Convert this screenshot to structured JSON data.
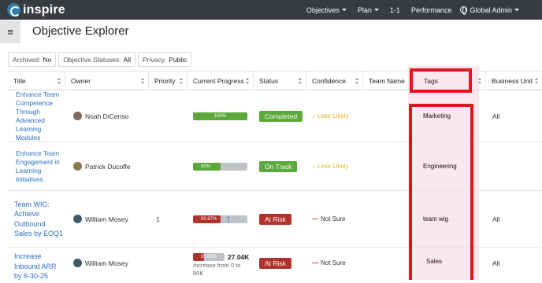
{
  "nav": {
    "logo": "inspire",
    "items": [
      {
        "label": "Objectives",
        "dropdown": true
      },
      {
        "label": "Plan",
        "dropdown": true
      },
      {
        "label": "1-1",
        "dropdown": false
      },
      {
        "label": "Performance",
        "dropdown": false
      },
      {
        "label": "Global Admin",
        "dropdown": true
      }
    ]
  },
  "header": {
    "title": "Objective Explorer",
    "menu_icon": "≡"
  },
  "filters": [
    {
      "label": "Archived:",
      "value": "No"
    },
    {
      "label": "Objective Statuses:",
      "value": "All"
    },
    {
      "label": "Privacy:",
      "value": "Public"
    }
  ],
  "columns": [
    "Title",
    "Owner",
    "Priority",
    "Current Progress",
    "Status",
    "Confidence",
    "Team Name",
    "Tags",
    "Business Unit"
  ],
  "rows": [
    {
      "title": "Enhance Team Competence Through Advanced Learning Modules",
      "owner": "Noah DiCenso",
      "priority": "",
      "progress_label": "100%",
      "progress_value": 100,
      "progress_color": "#5aa93a",
      "status": "Completed",
      "status_color": "#5aa93a",
      "confidence": "Less Likely",
      "confidence_icon": "↓",
      "confidence_color": "#e6b422",
      "team": "",
      "tag": "Marketing",
      "business_unit": "All"
    },
    {
      "title": "Enhance Team Engagement in Learning Initiatives",
      "owner": "Patrick Ducoffe",
      "priority": "",
      "progress_label": "50%",
      "progress_value": 50,
      "progress_color": "#5aa93a",
      "status": "On Track",
      "status_color": "#5aa93a",
      "confidence": "Less Likely",
      "confidence_icon": "↓",
      "confidence_color": "#e6b422",
      "team": "",
      "tag": "Engineering",
      "business_unit": ""
    },
    {
      "title": "Team WIG: Achieve Outbound Sales by EOQ1",
      "owner": "William Mosey",
      "priority": "1",
      "progress_label": "50.67%",
      "progress_value": 50.67,
      "progress_color": "#b0322a",
      "status": "At Risk",
      "status_color": "#b0322a",
      "confidence": "Not Sure",
      "confidence_icon": "—",
      "confidence_color": "#b0322a",
      "team": "",
      "tag": "team wig",
      "business_unit": "All"
    },
    {
      "title": "Increase Inbound ARR by 6-30-25",
      "owner": "William Mosey",
      "priority": "",
      "progress_label": "33.80%",
      "progress_value": 33.8,
      "progress_color": "#b0322a",
      "progress_amount": "27.04K",
      "progress_note": "Increase from 0 to 80K",
      "status": "At Risk",
      "status_color": "#b0322a",
      "confidence": "Not Sure",
      "confidence_icon": "—",
      "confidence_color": "#b0322a",
      "team": "",
      "tag": "Sales",
      "business_unit": "All"
    }
  ]
}
